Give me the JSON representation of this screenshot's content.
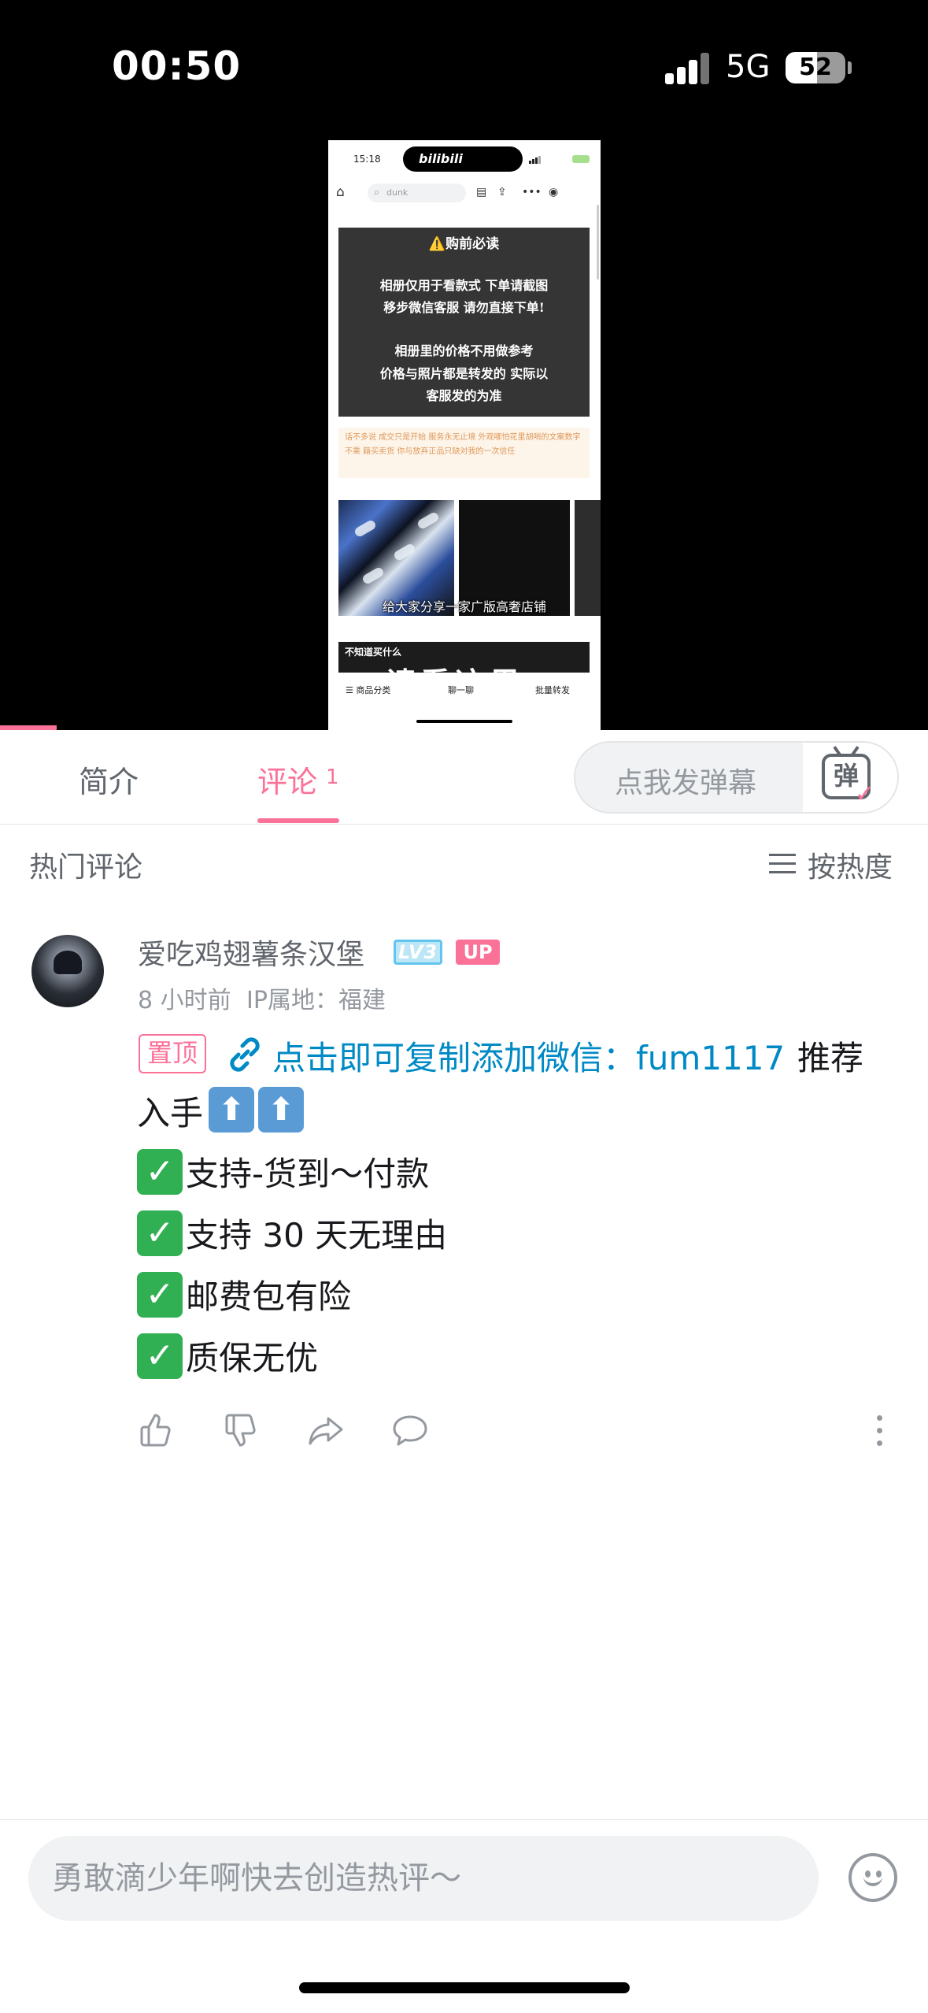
{
  "status_bar": {
    "time": "00:50",
    "network": "5G",
    "battery": "52",
    "battery_level": 0.52
  },
  "video": {
    "inner_screen": {
      "time": "15:18",
      "app_logo": "bilibili",
      "search_placeholder": "dunk",
      "notice_title": "⚠️购前必读",
      "notice_lines": [
        "相册仅用于看款式 下单请截图",
        "移步微信客服 请勿直接下单!",
        "相册里的价格不用做参考",
        "价格与照片都是转发的 实际以",
        "客服发的为准"
      ],
      "announcement": "话不多说 成交只是开始 服务永无止境 外观哪怕花里胡哨的文案数字不乘 籍买卖货 你与放弃正品只缺对我的一次信任",
      "product_caption": "给大家分享一家广版高奢店铺",
      "banner_top": "不知道买什么",
      "banner_big": "请看这里",
      "bottom_nav": [
        "☰ 商品分类",
        "聊一聊",
        "批量转发"
      ]
    }
  },
  "tabs": {
    "intro": "简介",
    "comments": "评论",
    "comments_count": "1",
    "danmaku_placeholder": "点我发弹幕",
    "danmaku_icon_char": "弹"
  },
  "comments_section": {
    "title": "热门评论",
    "sort_label": "按热度",
    "comment": {
      "username": "爱吃鸡翅薯条汉堡",
      "level": "LV3",
      "up_badge": "UP",
      "time": "8 小时前",
      "ip": "IP属地：福建",
      "pin_label": "置顶",
      "link_text": "点击即可复制添加微信：fum1117",
      "text_after_link": "推荐",
      "line2": "入手",
      "checks": [
        "支持-货到～付款",
        "支持 30 天无理由",
        "邮费包有险",
        "质保无优"
      ]
    }
  },
  "icons": {
    "like": "like-icon",
    "dislike": "dislike-icon",
    "share": "share-icon",
    "reply": "reply-icon",
    "more": "more-icon",
    "emoji": "emoji-icon"
  },
  "input": {
    "placeholder": "勇敢滴少年啊快去创造热评～"
  },
  "colors": {
    "accent": "#fb7299",
    "link": "#008ac5",
    "muted": "#9499a0"
  }
}
